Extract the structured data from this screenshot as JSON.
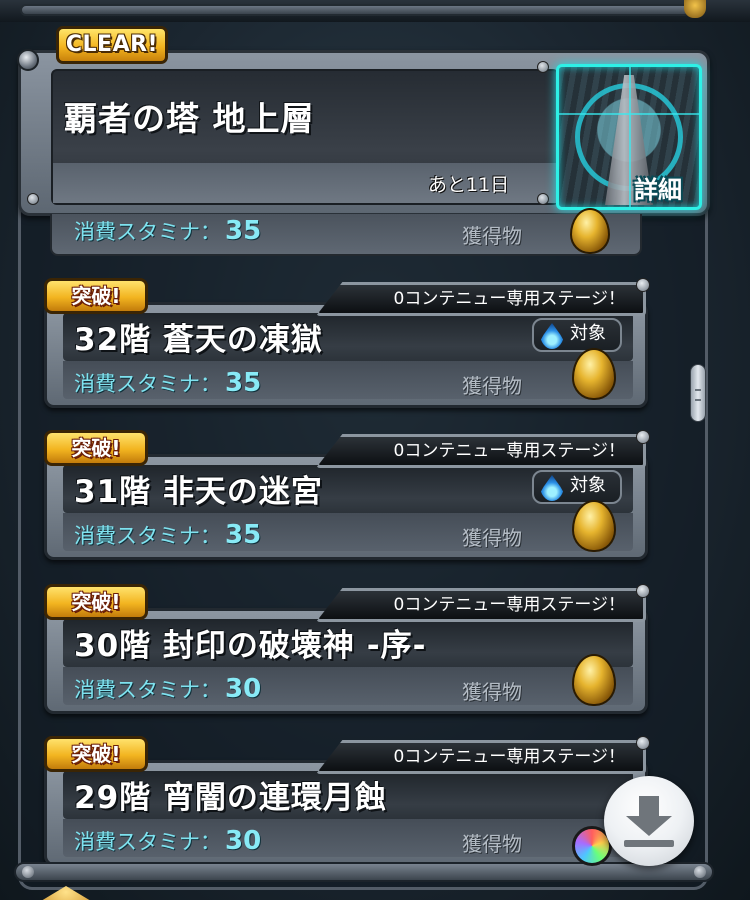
{
  "header": {
    "clear_badge": "CLEAR!",
    "title": "覇者の塔 地上層",
    "days_left": "あと11日",
    "detail_label": "詳細"
  },
  "partial_row": {
    "stamina_label": "消費スタミナ：",
    "stamina_value": "35",
    "reward_label": "獲得物"
  },
  "stages": [
    {
      "badge": "突破!",
      "continue_tag": "0コンテニュー専用ステージ！",
      "title": "32階 蒼天の凍獄",
      "target": "対象",
      "stamina_label": "消費スタミナ：",
      "stamina_value": "35",
      "reward_label": "獲得物",
      "reward": "egg-icon"
    },
    {
      "badge": "突破!",
      "continue_tag": "0コンテニュー専用ステージ！",
      "title": "31階 非天の迷宮",
      "target": "対象",
      "stamina_label": "消費スタミナ：",
      "stamina_value": "35",
      "reward_label": "獲得物",
      "reward": "egg-icon"
    },
    {
      "badge": "突破!",
      "continue_tag": "0コンテニュー専用ステージ！",
      "title": "30階 封印の破壊神 ‐序‐",
      "stamina_label": "消費スタミナ：",
      "stamina_value": "30",
      "reward_label": "獲得物",
      "reward": "egg-icon"
    },
    {
      "badge": "突破!",
      "continue_tag": "0コンテニュー専用ステージ！",
      "title": "29階 宵闇の連環月蝕",
      "stamina_label": "消費スタミナ：",
      "stamina_value": "30",
      "reward_label": "獲得物",
      "reward": "rainbow-orb-icon"
    }
  ],
  "icons": {
    "download": "download-icon",
    "water_element": "water-drop-icon"
  },
  "colors": {
    "stamina_text": "#7fe2ef",
    "badge_gold": "#f2b420",
    "detail_frame": "#2ef0e6"
  }
}
